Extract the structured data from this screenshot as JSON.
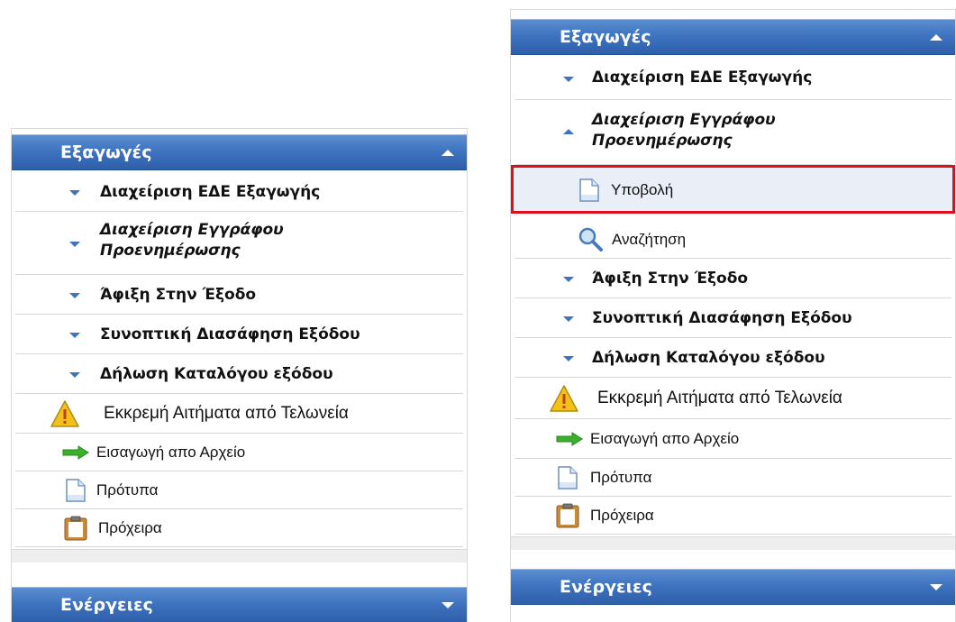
{
  "left_panel": {
    "header_title": "Εξαγωγές",
    "items": [
      {
        "label": "Διαχείριση ΕΔΕ Εξαγωγής"
      },
      {
        "label": "Διαχείριση Εγγράφου Προενημέρωσης"
      },
      {
        "label": "Άφιξη Στην Έξοδο"
      },
      {
        "label": "Συνοπτική Διασάφηση Εξόδου"
      },
      {
        "label": "Δήλωση Καταλόγου εξόδου"
      },
      {
        "label": "Εκκρεμή Αιτήματα από Τελωνεία",
        "icon": "warning-icon"
      },
      {
        "label": "Εισαγωγή απο Αρχείο",
        "icon": "green-arrow-icon"
      },
      {
        "label": "Πρότυπα",
        "icon": "document-icon"
      },
      {
        "label": "Πρόχειρα",
        "icon": "clipboard-icon"
      }
    ],
    "footer_title": "Ενέργειες"
  },
  "right_panel": {
    "header_title": "Εξαγωγές",
    "items": [
      {
        "label": "Διαχείριση ΕΔΕ Εξαγωγής"
      },
      {
        "label": "Διαχείριση Εγγράφου Προενημέρωσης"
      },
      {
        "label": "Υποβολή",
        "icon": "document-icon",
        "selected": true
      },
      {
        "label": "Αναζήτηση",
        "icon": "magnifier-icon"
      },
      {
        "label": "Άφιξη Στην Έξοδο"
      },
      {
        "label": "Συνοπτική Διασάφηση Εξόδου"
      },
      {
        "label": "Δήλωση Καταλόγου εξόδου"
      },
      {
        "label": "Εκκρεμή Αιτήματα από Τελωνεία",
        "icon": "warning-icon"
      },
      {
        "label": "Εισαγωγή απο Αρχείο",
        "icon": "green-arrow-icon"
      },
      {
        "label": "Πρότυπα",
        "icon": "document-icon"
      },
      {
        "label": "Πρόχειρα",
        "icon": "clipboard-icon"
      }
    ],
    "footer_title": "Ενέργειες"
  },
  "colors": {
    "header_blue": "#3f74c0",
    "highlight_border": "#e0101a",
    "arrow_green": "#3cb02c",
    "warning_yellow": "#f2c21a"
  }
}
